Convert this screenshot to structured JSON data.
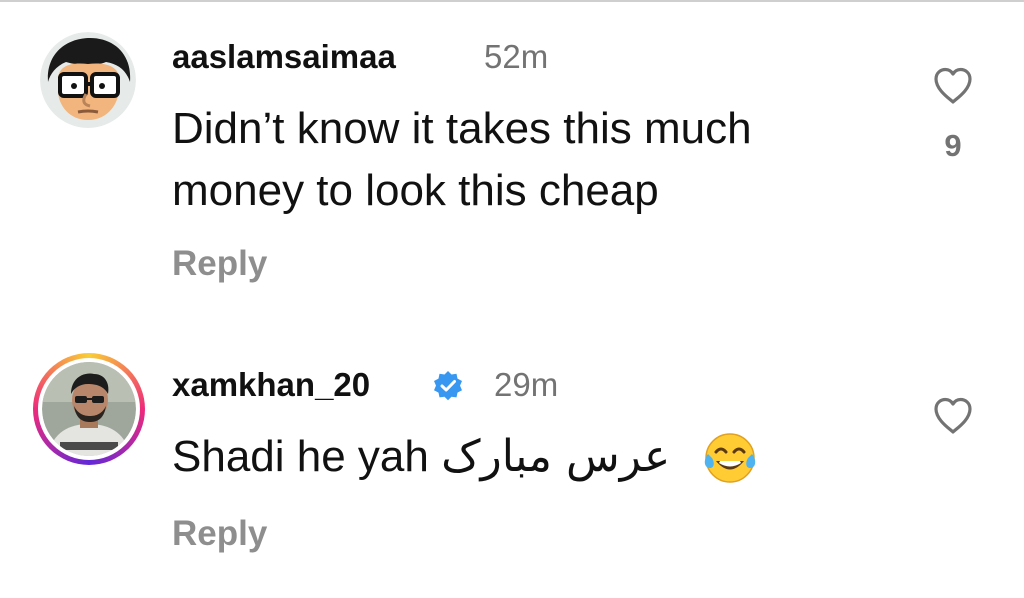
{
  "comments": [
    {
      "username": "aaslamsaimaa",
      "time": "52m",
      "line1": "Didn’t know it takes this much",
      "line2": "money to look this cheap",
      "reply_label": "Reply",
      "likes": "9",
      "avatar_icon": "cartoon-glasses-avatar",
      "heart_icon": "heart-outline-icon"
    },
    {
      "username": "xamkhan_20",
      "verified": true,
      "time": "29m",
      "text_latin": "Shadi he yah",
      "text_urdu": "عرس مبارک",
      "emoji": "face-with-tears-of-joy",
      "reply_label": "Reply",
      "avatar_icon": "man-photo-avatar",
      "heart_icon": "heart-outline-icon"
    }
  ],
  "colors": {
    "text_primary": "#111111",
    "text_secondary": "#737373",
    "reply": "#8e8e8e",
    "verified": "#3897f0"
  }
}
